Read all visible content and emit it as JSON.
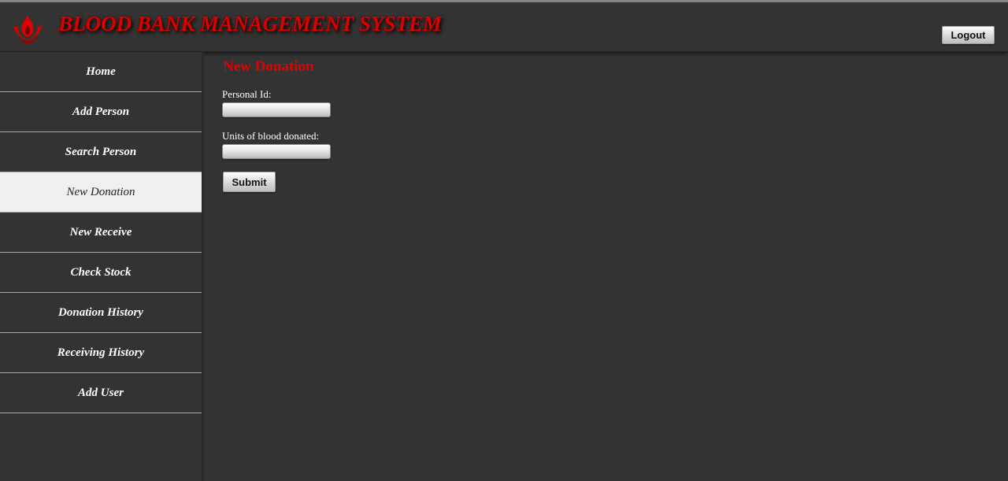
{
  "header": {
    "title": "BLOOD BANK MANAGEMENT SYSTEM",
    "logo_icon": "blood-drop-flame-icon",
    "logout_label": "Logout"
  },
  "sidebar": {
    "items": [
      {
        "label": "Home",
        "active": false
      },
      {
        "label": "Add Person",
        "active": false
      },
      {
        "label": "Search Person",
        "active": false
      },
      {
        "label": "New Donation",
        "active": true
      },
      {
        "label": "New Receive",
        "active": false
      },
      {
        "label": "Check Stock",
        "active": false
      },
      {
        "label": "Donation History",
        "active": false
      },
      {
        "label": "Receiving History",
        "active": false
      },
      {
        "label": "Add User",
        "active": false
      }
    ]
  },
  "form": {
    "title": "New Donation",
    "personal_id_label": "Personal Id:",
    "personal_id_value": "",
    "units_label": "Units of blood donated:",
    "units_value": "",
    "submit_label": "Submit"
  },
  "colors": {
    "background": "#333333",
    "accent_red": "#d90000",
    "active_nav_bg": "#efefef"
  }
}
